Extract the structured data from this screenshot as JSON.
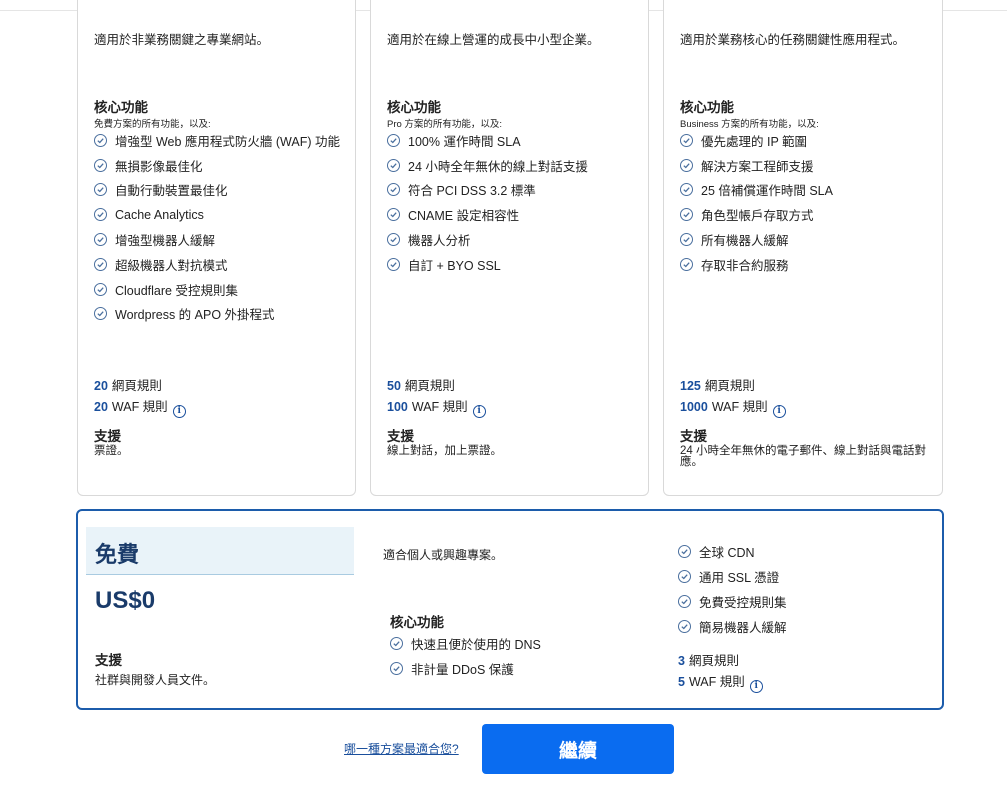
{
  "plans": [
    {
      "description": "適用於非業務關鍵之專業網站。",
      "core_heading": "核心功能",
      "includes": "免費方案的所有功能，以及:",
      "features": [
        "增強型 Web 應用程式防火牆 (WAF) 功能",
        "無損影像最佳化",
        "自動行動裝置最佳化",
        "Cache Analytics",
        "增強型機器人緩解",
        "超級機器人對抗模式",
        "Cloudflare 受控規則集",
        "Wordpress 的 APO 外掛程式"
      ],
      "page_rules_num": "20",
      "page_rules_label": "網頁規則",
      "waf_rules_num": "20",
      "waf_rules_label": "WAF 規則",
      "support_heading": "支援",
      "support_text": "票證。"
    },
    {
      "description": "適用於在線上營運的成長中小型企業。",
      "core_heading": "核心功能",
      "includes": "Pro 方案的所有功能，以及:",
      "features": [
        "100% 運作時間 SLA",
        "24 小時全年無休的線上對話支援",
        "符合 PCI DSS 3.2 標準",
        "CNAME 設定相容性",
        "機器人分析",
        "自訂 + BYO SSL"
      ],
      "page_rules_num": "50",
      "page_rules_label": "網頁規則",
      "waf_rules_num": "100",
      "waf_rules_label": "WAF 規則",
      "support_heading": "支援",
      "support_text": "線上對話，加上票證。"
    },
    {
      "description": "適用於業務核心的任務關鍵性應用程式。",
      "core_heading": "核心功能",
      "includes": "Business 方案的所有功能，以及:",
      "features": [
        "優先處理的 IP 範圍",
        "解決方案工程師支援",
        "25 倍補償運作時間 SLA",
        "角色型帳戶存取方式",
        "所有機器人緩解",
        "存取非合約服務"
      ],
      "page_rules_num": "125",
      "page_rules_label": "網頁規則",
      "waf_rules_num": "1000",
      "waf_rules_label": "WAF 規則",
      "support_heading": "支援",
      "support_text": "24 小時全年無休的電子郵件、線上對話與電話對應。"
    }
  ],
  "free_plan": {
    "name": "免費",
    "price": "US$0",
    "support_heading": "支援",
    "support_text": "社群與開發人員文件。",
    "description": "適合個人或興趣專案。",
    "core_heading": "核心功能",
    "core_features": [
      "快速且便於使用的 DNS",
      "非計量 DDoS 保護"
    ],
    "features": [
      "全球 CDN",
      "通用 SSL 憑證",
      "免費受控規則集",
      "簡易機器人緩解"
    ],
    "page_rules_num": "3",
    "page_rules_label": "網頁規則",
    "waf_rules_num": "5",
    "waf_rules_label": "WAF 規則"
  },
  "footer": {
    "help_link": "哪一種方案最適合您?",
    "continue_label": "繼續"
  },
  "icons": {
    "check": "check-circle-icon",
    "info": "info-icon"
  },
  "colors": {
    "accent": "#0a6cf0",
    "border_selected": "#1c5cab",
    "title": "#1a3b6a",
    "link": "#1a4f9c"
  }
}
